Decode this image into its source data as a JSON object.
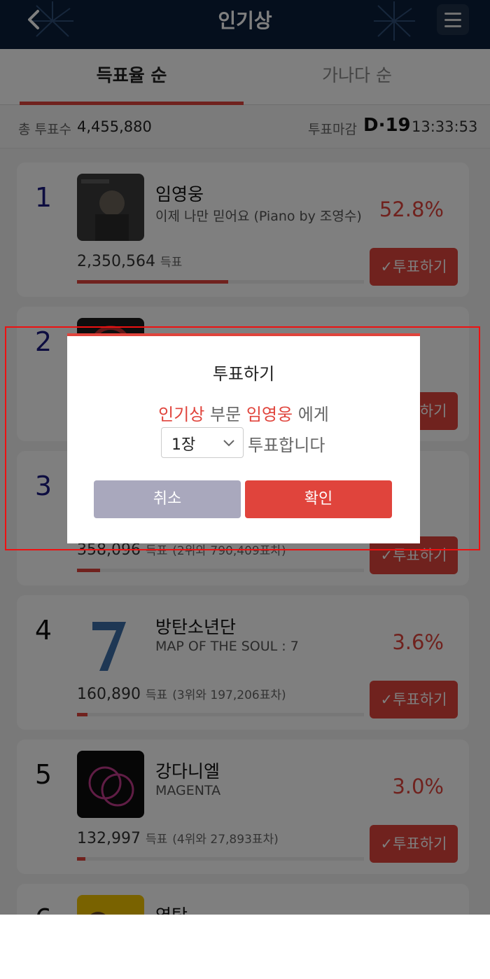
{
  "header": {
    "title": "인기상"
  },
  "tabs": [
    {
      "label": "득표율 순",
      "active": true
    },
    {
      "label": "가나다 순",
      "active": false
    }
  ],
  "summary": {
    "total_label": "총 투표수",
    "total_value": "4,455,880",
    "deadline_label": "투표마감",
    "dday": "D·19",
    "time": "13:33:53"
  },
  "entries": [
    {
      "rank": "1",
      "name": "임영웅",
      "song": "이제 나만 믿어요 (Piano by 조영수)",
      "percent": "52.8%",
      "votes": "2,350,564",
      "votes_unit": "득표",
      "votes_note": "",
      "share": 0.528,
      "button": "투표하기"
    },
    {
      "rank": "2",
      "name": "",
      "song": "",
      "percent": "",
      "votes": "",
      "votes_unit": "",
      "votes_note": "",
      "share": 0.0,
      "button": "투표하기"
    },
    {
      "rank": "3",
      "name": "",
      "song": "",
      "percent": "",
      "votes": "358,096",
      "votes_unit": "득표",
      "votes_note": "(2위와 790,409표차)",
      "share": 0.08,
      "button": "투표하기"
    },
    {
      "rank": "4",
      "name": "방탄소년단",
      "song": "MAP OF THE SOUL : 7",
      "percent": "3.6%",
      "votes": "160,890",
      "votes_unit": "득표",
      "votes_note": "(3위와 197,206표차)",
      "share": 0.036,
      "button": "투표하기"
    },
    {
      "rank": "5",
      "name": "강다니엘",
      "song": "MAGENTA",
      "percent": "3.0%",
      "votes": "132,997",
      "votes_unit": "득표",
      "votes_note": "(4위와 27,893표차)",
      "share": 0.03,
      "button": "투표하기"
    },
    {
      "rank": "6",
      "name": "영탁",
      "song": "",
      "percent": "",
      "votes": "",
      "votes_unit": "",
      "votes_note": "",
      "share": 0.0,
      "button": ""
    }
  ],
  "modal": {
    "title": "투표하기",
    "category": "인기상",
    "text_part": "부문",
    "artist": "임영웅",
    "text_to": "에게",
    "select_value": "1장",
    "text_vote": "투표합니다",
    "cancel_label": "취소",
    "confirm_label": "확인"
  },
  "colors": {
    "accent": "#e0443c",
    "header_bg": "#0b1f3a",
    "cancel_bg": "#a9a8bd",
    "rank_top": "#1a1a80"
  },
  "icons": {
    "back": "chevron-left-icon",
    "menu": "hamburger-menu-icon",
    "check": "check-icon",
    "dropdown": "chevron-down-icon"
  }
}
